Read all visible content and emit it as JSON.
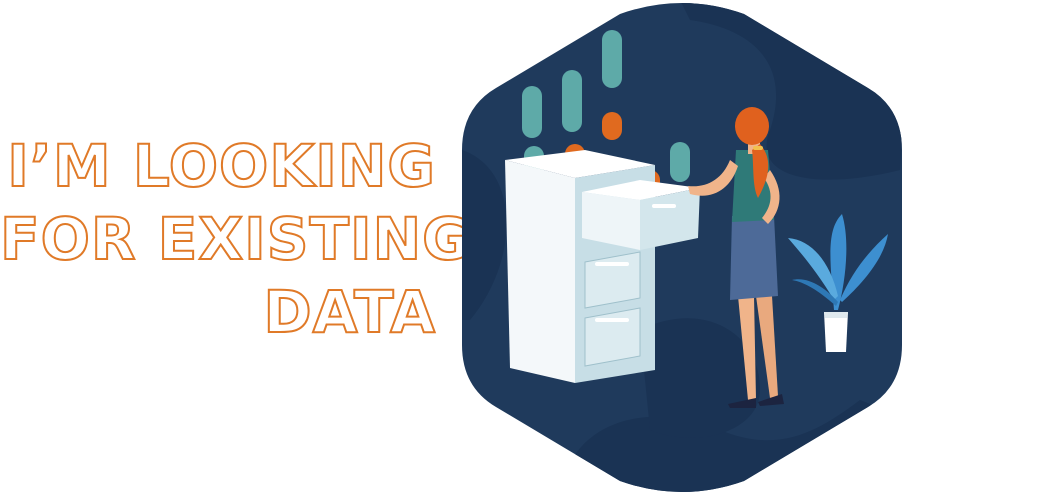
{
  "headline": {
    "lines": [
      "I’M LOOKING",
      "FOR EXISTING",
      "DATA"
    ]
  },
  "illustration": {
    "subject": "woman searching filing cabinet",
    "icons": [
      "filing-cabinet-icon",
      "woman-figure-icon",
      "potted-plant-icon"
    ]
  },
  "colors": {
    "accent": "#e07a28",
    "hexagon": "#1f3a5c",
    "hexagon_shade": "#1a3354",
    "teal": "#5eaaa8",
    "cabinet": "#eef4f7"
  }
}
